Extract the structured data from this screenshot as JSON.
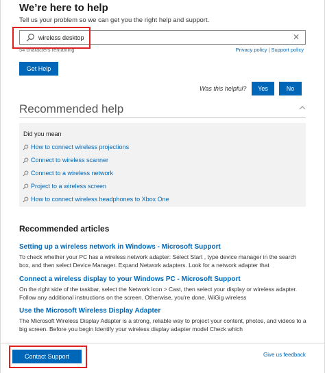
{
  "header": {
    "title": "We’re here to help",
    "subtitle": "Tell us your problem so we can get you the right help and support."
  },
  "search": {
    "value": "wireless desktop",
    "char_count": "54 characters remaining",
    "icon": "search-icon",
    "clear_icon": "close-icon"
  },
  "policy": {
    "privacy": "Privacy policy",
    "separator": "|",
    "support": "Support policy"
  },
  "actions": {
    "get_help": "Get Help",
    "helpful_question": "Was this helpful?",
    "yes": "Yes",
    "no": "No"
  },
  "recommended_help": {
    "title": "Recommended help",
    "did_you_mean": "Did you mean",
    "suggestions": [
      "How to connect wireless projections",
      "Connect to wireless scanner",
      "Connect to a wireless network",
      "Project to a wireless screen",
      "How to connect wireless headphones to Xbox One"
    ]
  },
  "recommended_articles": {
    "title": "Recommended articles",
    "items": [
      {
        "title": "Setting up a wireless network in Windows - Microsoft Support",
        "snippet": "To check whether your PC has a wireless network adapter: Select Start , type device manager in the search box, and then select Device Manager. Expand Network adapters. Look for a network adapter that"
      },
      {
        "title": "Connect a wireless display to your Windows PC - Microsoft Support",
        "snippet": "On the right side of the taskbar, select the Network icon > Cast, then select your display or wireless adapter. Follow any additional instructions on the screen. Otherwise, you're done. WiGig wireless"
      },
      {
        "title": "Use the Microsoft Wireless Display Adapter",
        "snippet": "The Microsoft Wireless Display Adapter is a strong, reliable way to project your content, photos, and videos to a big screen. Before you begin Identify your wireless display adapter model Check which"
      }
    ]
  },
  "footer": {
    "contact_support": "Contact Support",
    "feedback": "Give us feedback"
  },
  "colors": {
    "accent": "#0067b8",
    "highlight": "#e02020",
    "suggestion_bg": "#f2f2f2"
  }
}
